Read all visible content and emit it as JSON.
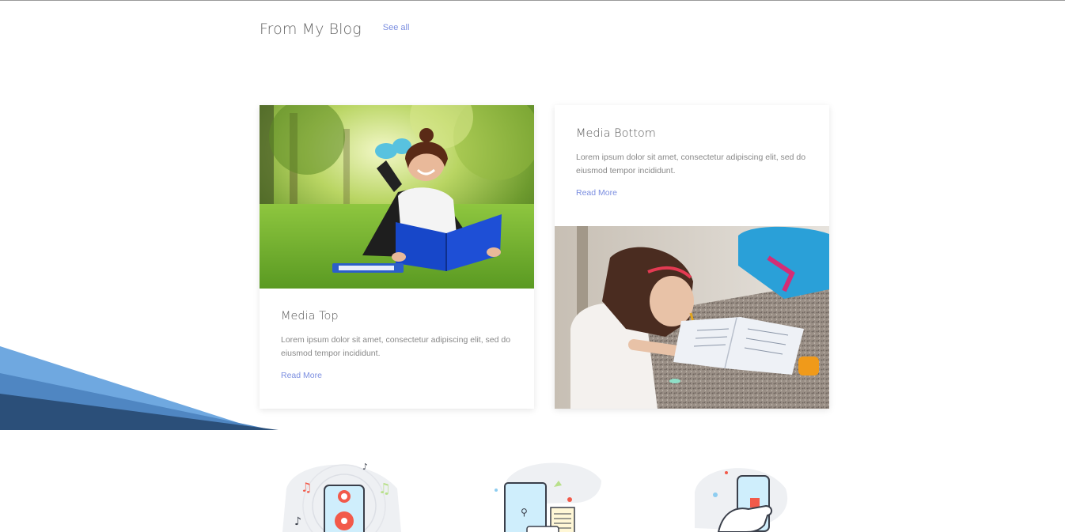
{
  "blog": {
    "title": "From My Blog",
    "see_all": "See all"
  },
  "cards": [
    {
      "title": "Media Top",
      "text": "Lorem ipsum dolor sit amet, consectetur adipiscing elit, sed do eiusmod tempor incididunt.",
      "read_more": "Read More"
    },
    {
      "title": "Media Bottom",
      "text": "Lorem ipsum dolor sit amet, consectetur adipiscing elit, sed do eiusmod tempor incididunt.",
      "read_more": "Read More"
    }
  ],
  "colors": {
    "accent_link": "#7b8ee0",
    "wave_light": "#6fa8e0",
    "wave_mid": "#4f86c2",
    "wave_dark": "#2b4f79"
  },
  "icons": [
    "music-player-icon",
    "tablet-notes-icon",
    "phone-in-hand-icon"
  ]
}
